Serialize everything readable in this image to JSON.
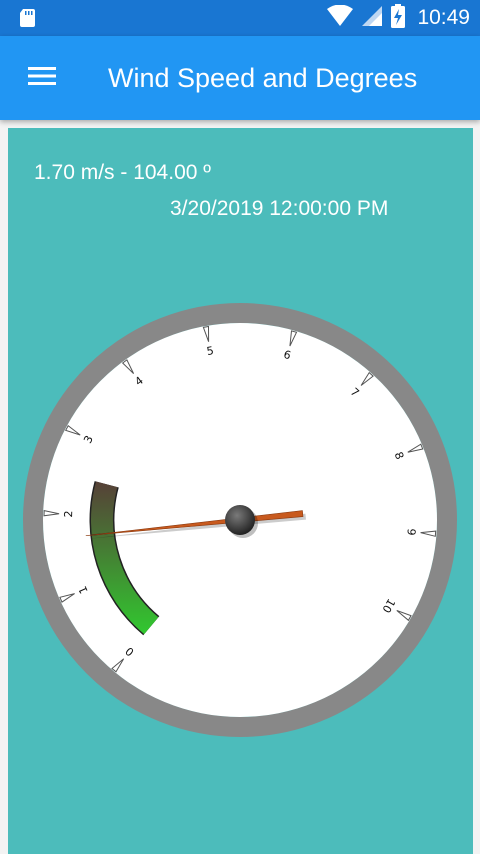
{
  "status_bar": {
    "time": "10:49",
    "icons": [
      "sd-card-icon",
      "wifi-icon",
      "cell-signal-icon",
      "battery-charging-icon"
    ]
  },
  "app_bar": {
    "menu_icon": "hamburger-menu-icon",
    "title": "Wind Speed and Degrees"
  },
  "reading": {
    "text": "1.70 m/s - 104.00 º",
    "timestamp": "3/20/2019 12:00:00 PM"
  },
  "gauge": {
    "min": 0,
    "max": 10,
    "scale_labels": [
      "0",
      "1",
      "2",
      "3",
      "4",
      "5",
      "6",
      "7",
      "8",
      "9",
      "10"
    ],
    "value": 1.7,
    "range_band": {
      "from": 0,
      "to": 2.5,
      "colors": {
        "low": "#2fcf2f",
        "high": "#5a3338"
      }
    },
    "colors": {
      "face": "#ffffff",
      "rim": "#888888",
      "needle": "#c85a1e",
      "hub": "#3a3a3a",
      "background": "#4cbcbb"
    }
  }
}
